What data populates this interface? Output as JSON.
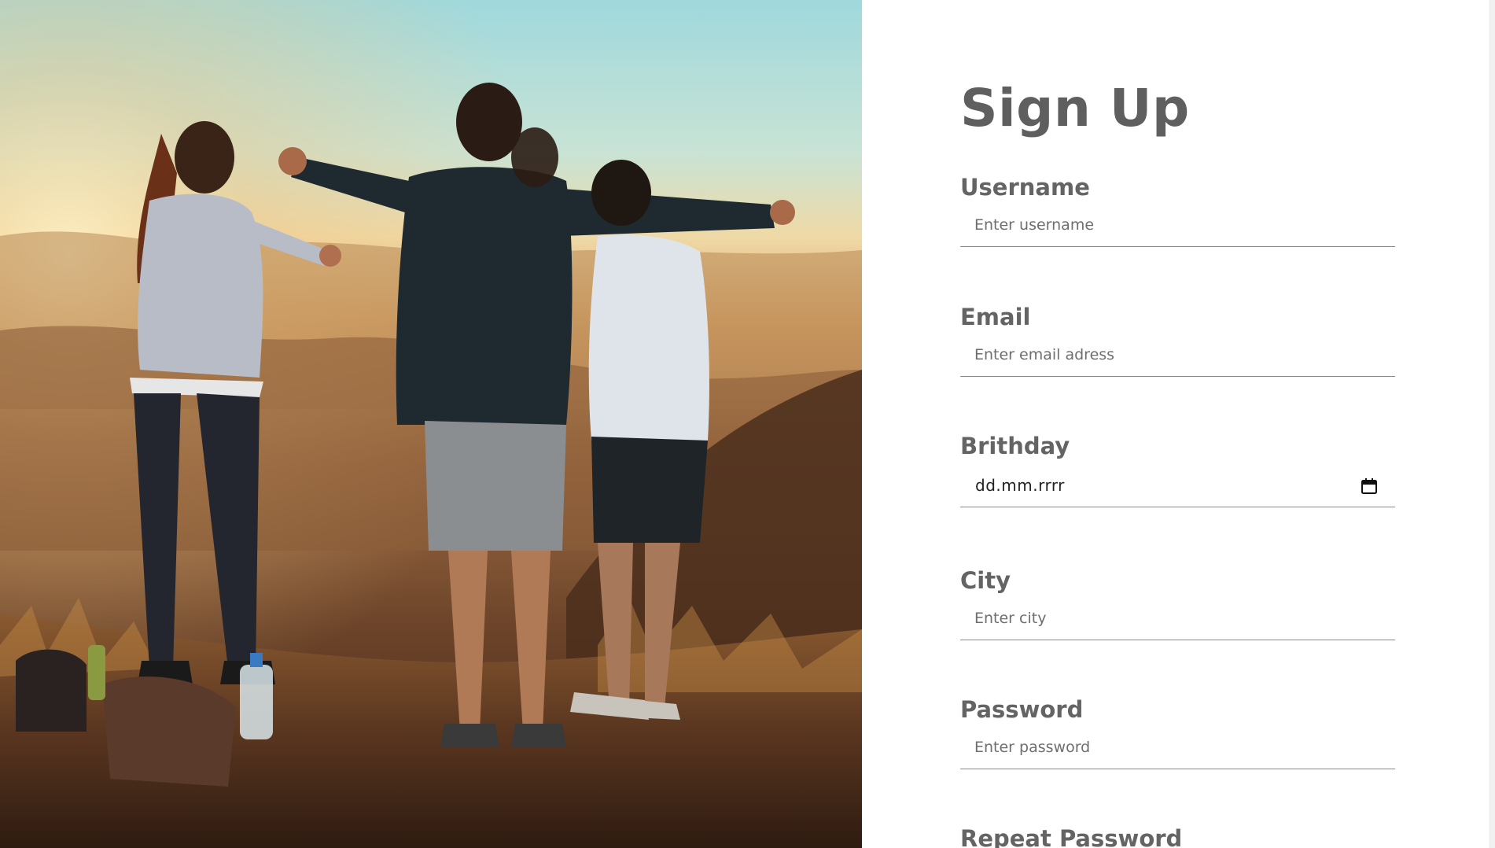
{
  "photo": {
    "alt": "",
    "description_icon": "photo-image"
  },
  "form": {
    "title": "Sign Up",
    "fields": {
      "username": {
        "label": "Username",
        "placeholder": "Enter username",
        "value": ""
      },
      "email": {
        "label": "Email",
        "placeholder": "Enter email adress",
        "value": ""
      },
      "birthday": {
        "label": "Brithday",
        "value": "dd.mm.rrrr",
        "icon": "calendar-icon"
      },
      "city": {
        "label": "City",
        "placeholder": "Enter city",
        "value": ""
      },
      "password": {
        "label": "Password",
        "placeholder": "Enter password",
        "value": ""
      },
      "repeat_password": {
        "label": "Repeat Password"
      }
    }
  },
  "colors": {
    "title": "#5f5f5f",
    "label": "#646464",
    "placeholder": "#6e6e6e",
    "underline": "#8a8a8a",
    "background": "#ffffff"
  }
}
